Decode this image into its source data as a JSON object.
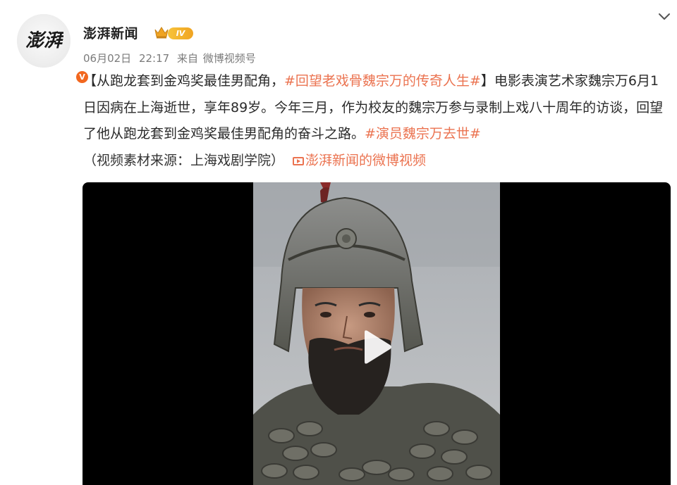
{
  "author": {
    "avatar_text": "澎湃",
    "name": "澎湃新闻",
    "level_badge": "IV",
    "verified_icon": "verified-v-icon"
  },
  "meta": {
    "date": "06月02日",
    "time": "22:17",
    "source_prefix": "来自",
    "source_app": "微博视频号"
  },
  "post": {
    "bracket_open": "【从跑龙套到金鸡奖最佳男配角，",
    "topic1": "#回望老戏骨魏宗万的传奇人生#",
    "bracket_close": "】",
    "body": "电影表演艺术家魏宗万6月1日因病在上海逝世，享年89岁。今年三月，作为校友的魏宗万参与录制上戏八十周年的访谈，回望了他从跑龙套到金鸡奖最佳男配角的奋斗之路。",
    "topic2": "#演员魏宗万去世#",
    "source_note": "（视频素材来源：上海戏剧学院）",
    "video_link": "澎湃新闻的微博视频"
  },
  "video": {
    "play_icon": "play-icon"
  },
  "colors": {
    "link": "#eb7350",
    "verified": "#f2671f",
    "badge": "#f0a422"
  }
}
